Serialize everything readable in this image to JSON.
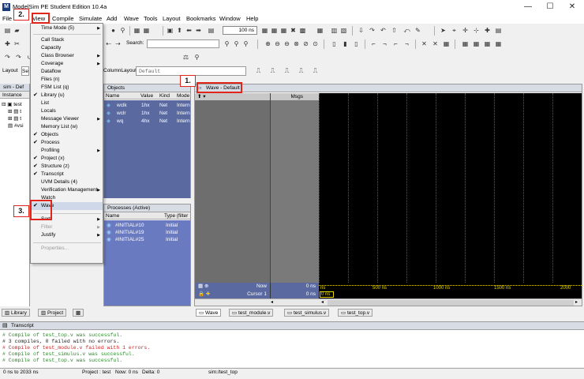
{
  "window": {
    "title": "ModelSim PE Student Edition 10.4a",
    "app_icon": "M",
    "min": "—",
    "max": "☐",
    "close": "✕"
  },
  "menubar": [
    "File",
    "View",
    "Compile",
    "Simulate",
    "Add",
    "Wave",
    "Tools",
    "Layout",
    "Bookmarks",
    "Window",
    "Help"
  ],
  "toolbar": {
    "zoom_value": "100 ns",
    "search_label": "Search:",
    "layout_label": "Layout",
    "layout_value": "Se",
    "column_layout_label": "ColumnLayout",
    "column_layout_value": "Default"
  },
  "view_menu": {
    "items": [
      {
        "label": "Time Mode (5)",
        "check": false,
        "sub": true,
        "disabled": false
      },
      {
        "label": "Call Stack",
        "check": false,
        "sub": false,
        "disabled": false
      },
      {
        "label": "Capacity",
        "check": false,
        "sub": false,
        "disabled": false
      },
      {
        "label": "Class Browser",
        "check": false,
        "sub": true,
        "disabled": false
      },
      {
        "label": "Coverage",
        "check": false,
        "sub": true,
        "disabled": false
      },
      {
        "label": "Dataflow",
        "check": false,
        "sub": false,
        "disabled": false
      },
      {
        "label": "Files (n)",
        "check": false,
        "sub": false,
        "disabled": false
      },
      {
        "label": "FSM List (q)",
        "check": false,
        "sub": false,
        "disabled": false
      },
      {
        "label": "Library (u)",
        "check": true,
        "sub": false,
        "disabled": false
      },
      {
        "label": "List",
        "check": false,
        "sub": false,
        "disabled": false
      },
      {
        "label": "Locals",
        "check": false,
        "sub": false,
        "disabled": false
      },
      {
        "label": "Message Viewer",
        "check": false,
        "sub": true,
        "disabled": false
      },
      {
        "label": "Memory List (w)",
        "check": false,
        "sub": false,
        "disabled": false
      },
      {
        "label": "Objects",
        "check": true,
        "sub": false,
        "disabled": false
      },
      {
        "label": "Process",
        "check": true,
        "sub": false,
        "disabled": false
      },
      {
        "label": "Profiling",
        "check": false,
        "sub": true,
        "disabled": false
      },
      {
        "label": "Project (x)",
        "check": true,
        "sub": false,
        "disabled": false
      },
      {
        "label": "Structure (z)",
        "check": true,
        "sub": false,
        "disabled": false
      },
      {
        "label": "Transcript",
        "check": true,
        "sub": false,
        "disabled": false
      },
      {
        "label": "UVM Details (4)",
        "check": false,
        "sub": false,
        "disabled": false
      },
      {
        "label": "Verification Management",
        "check": false,
        "sub": true,
        "disabled": false
      },
      {
        "label": "Watch",
        "check": false,
        "sub": false,
        "disabled": false
      },
      {
        "label": "Wave",
        "check": true,
        "sub": false,
        "disabled": false
      },
      {
        "label": "Sort",
        "check": false,
        "sub": true,
        "disabled": false
      },
      {
        "label": "Filter",
        "check": false,
        "sub": true,
        "disabled": true
      },
      {
        "label": "Justify",
        "check": false,
        "sub": true,
        "disabled": false
      },
      {
        "label": "Properties...",
        "check": false,
        "sub": false,
        "disabled": true
      }
    ]
  },
  "annotations": [
    "1.",
    "2.",
    "3."
  ],
  "left_pane": {
    "title": "sim - Def",
    "header": "Instance",
    "rows": [
      "test",
      "t",
      "t",
      "#vsi"
    ]
  },
  "objects_pane": {
    "title": "Objects",
    "columns": [
      "Name",
      "Value",
      "Kind",
      "Mode"
    ],
    "rows": [
      {
        "name": "wclk",
        "value": "1hx",
        "kind": "Net",
        "mode": "Intern"
      },
      {
        "name": "wclr",
        "value": "1hx",
        "kind": "Net",
        "mode": "Intern"
      },
      {
        "name": "wq",
        "value": "4hx",
        "kind": "Net",
        "mode": "Intern"
      }
    ]
  },
  "process_pane": {
    "title": "Processes (Active)",
    "columns": [
      "Name",
      "Type (filter"
    ],
    "rows": [
      {
        "name": "#INITIAL#10",
        "type": "Initial"
      },
      {
        "name": "#INITIAL#19",
        "type": "Initial"
      },
      {
        "name": "#INITIAL#25",
        "type": "Initial"
      }
    ]
  },
  "wave_pane": {
    "title": "Wave - Default",
    "msgs_header": "Msgs",
    "now_label": "Now",
    "now_value": "0 ns",
    "cursor_label": "Cursor 1",
    "cursor_value": "0 ns",
    "cursor_time_box": "0 ns",
    "ruler_labels": [
      "ns",
      "500 ns",
      "1000 ns",
      "1500 ns",
      "2000"
    ]
  },
  "left_tabs": [
    "Library",
    "Project"
  ],
  "wave_tabs": [
    "Wave",
    "test_module.v",
    "test_simulus.v",
    "test_top.v"
  ],
  "transcript": {
    "title": "Transcript",
    "lines": [
      {
        "text": "# Compile of test_top.v was successful.",
        "color": "#2a8a2a"
      },
      {
        "text": "# 3 compiles, 0 failed with no errors.",
        "color": "#222222"
      },
      {
        "text": "# Compile of test_module.v failed with 1 errors.",
        "color": "#d02020"
      },
      {
        "text": "# Compile of test_simulus.v was successful.",
        "color": "#2a8a2a"
      },
      {
        "text": "# Compile of test_top.v was successful.",
        "color": "#2a8a2a"
      }
    ]
  },
  "statusbar": {
    "range": "0 ns to 2033 ns",
    "project": "Project : test",
    "now": "Now: 0 ns",
    "delta": "Delta: 0",
    "sim": "sim:/test_top"
  },
  "colors": {
    "accent_red": "#e0261a",
    "selection_blue": "#5a6aa0",
    "wave_bg": "#000000",
    "ruler_yellow": "#e8d800"
  }
}
